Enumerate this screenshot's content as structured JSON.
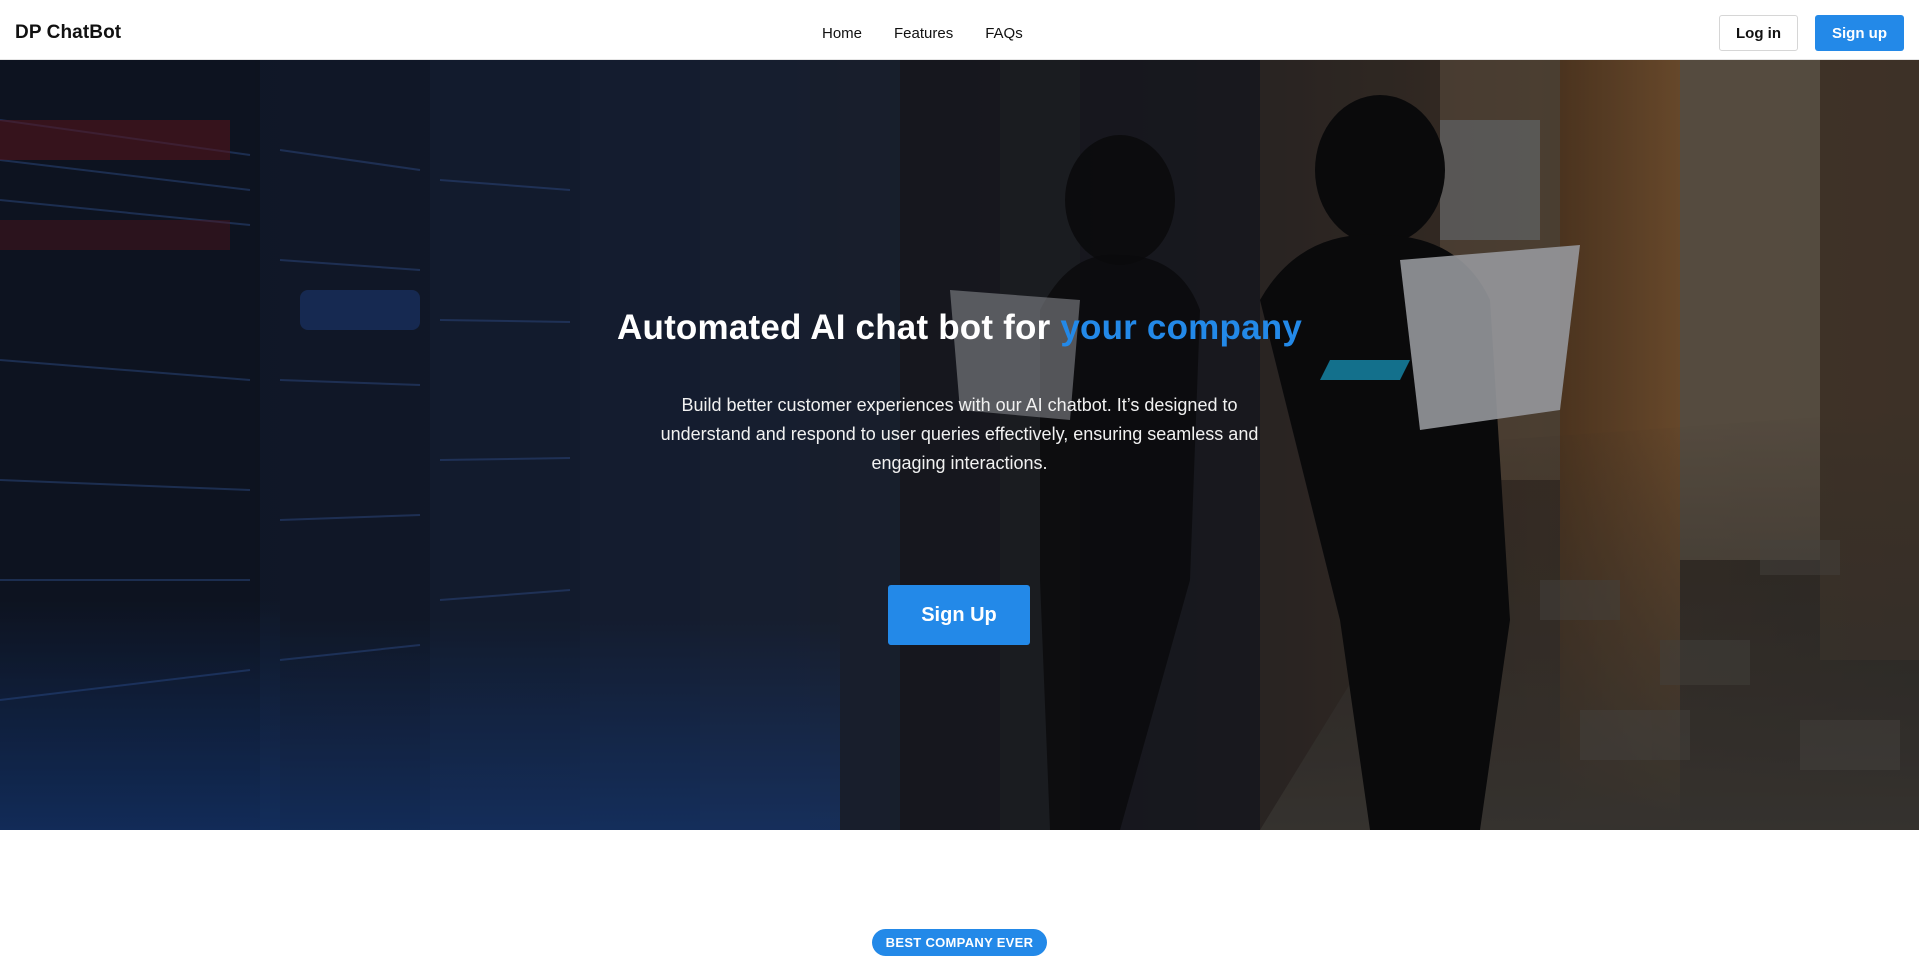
{
  "header": {
    "brand": "DP ChatBot",
    "nav": [
      {
        "label": "Home"
      },
      {
        "label": "Features"
      },
      {
        "label": "FAQs"
      }
    ],
    "login_label": "Log in",
    "signup_label": "Sign up"
  },
  "hero": {
    "title_main": "Automated AI chat bot for ",
    "title_accent": "your company",
    "subtitle": "Build better customer experiences with our AI chatbot. It’s designed to understand and respond to user queries effectively, ensuring seamless and engaging interactions.",
    "cta_label": "Sign Up"
  },
  "section": {
    "badge": "BEST COMPANY EVER"
  },
  "colors": {
    "accent": "#2389e8",
    "header_bg": "#ffffff",
    "text_dark": "#111111"
  }
}
